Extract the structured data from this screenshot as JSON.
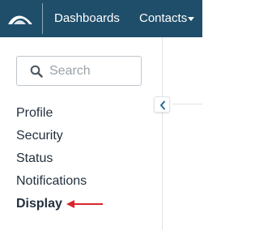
{
  "topbar": {
    "nav": {
      "dashboards_label": "Dashboards",
      "contacts_label": "Contacts"
    }
  },
  "sidebar": {
    "search": {
      "placeholder": "Search",
      "value": ""
    },
    "items": [
      {
        "label": "Profile"
      },
      {
        "label": "Security"
      },
      {
        "label": "Status"
      },
      {
        "label": "Notifications"
      },
      {
        "label": "Display",
        "active": true
      }
    ]
  },
  "colors": {
    "topbar_bg": "#1f4e6a",
    "text": "#22313f",
    "annotation_arrow": "#d9262c"
  },
  "icons": {
    "logo": "brand-logo",
    "search": "search-icon",
    "caret": "chevron-down-icon",
    "collapse": "chevron-left-icon"
  }
}
